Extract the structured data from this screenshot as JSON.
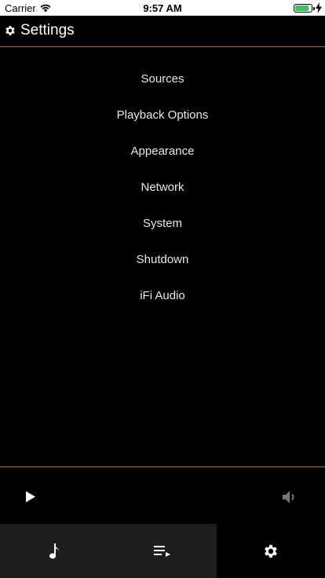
{
  "status_bar": {
    "carrier": "Carrier",
    "time": "9:57 AM",
    "battery_color": "#34c759"
  },
  "header": {
    "title": "Settings",
    "icon": "gear-icon",
    "accent_color": "#e0522b"
  },
  "menu": {
    "items": [
      {
        "label": "Sources"
      },
      {
        "label": "Playback Options"
      },
      {
        "label": "Appearance"
      },
      {
        "label": "Network"
      },
      {
        "label": "System"
      },
      {
        "label": "Shutdown"
      },
      {
        "label": "iFi Audio"
      }
    ]
  },
  "player": {
    "play_icon": "play-icon",
    "volume_icon": "volume-icon"
  },
  "tabbar": {
    "tabs": [
      {
        "icon": "music-note-icon",
        "active": false
      },
      {
        "icon": "queue-list-icon",
        "active": false
      },
      {
        "icon": "gear-icon",
        "active": true
      }
    ]
  }
}
